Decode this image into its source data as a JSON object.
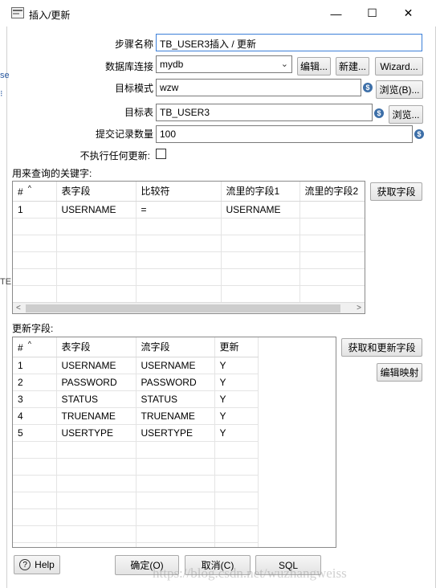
{
  "window": {
    "title": "插入/更新",
    "minimize_glyph": "—",
    "maximize_glyph": "☐",
    "close_glyph": "✕"
  },
  "form": {
    "step_name_label": "步骤名称",
    "step_name_value": "TB_USER3插入 / 更新",
    "db_connection_label": "数据库连接",
    "db_connection_value": "mydb",
    "edit_button": "编辑...",
    "new_button": "新建...",
    "wizard_button": "Wizard...",
    "target_schema_label": "目标模式",
    "target_schema_value": "wzw",
    "browse_b_button": "浏览(B)...",
    "target_table_label": "目标表",
    "target_table_value": "TB_USER3",
    "browse_button": "浏览...",
    "commit_size_label": "提交记录数量",
    "commit_size_value": "100",
    "no_update_label": "不执行任何更新:",
    "no_update_checked": false,
    "variable_icon": "$"
  },
  "key_section": {
    "label": "用来查询的关键字:",
    "get_fields_button": "获取字段",
    "columns": [
      "#",
      "表字段",
      "比较符",
      "流里的字段1",
      "流里的字段2"
    ],
    "rows": [
      [
        "1",
        "USERNAME",
        "=",
        "USERNAME",
        ""
      ]
    ],
    "empty_rows": 6
  },
  "update_section": {
    "label": "更新字段:",
    "get_update_fields_button": "获取和更新字段",
    "edit_mapping_button": "编辑映射",
    "columns": [
      "#",
      "表字段",
      "流字段",
      "更新"
    ],
    "rows": [
      [
        "1",
        "USERNAME",
        "USERNAME",
        "Y"
      ],
      [
        "2",
        "PASSWORD",
        "PASSWORD",
        "Y"
      ],
      [
        "3",
        "STATUS",
        "STATUS",
        "Y"
      ],
      [
        "4",
        "TRUENAME",
        "TRUENAME",
        "Y"
      ],
      [
        "5",
        "USERTYPE",
        "USERTYPE",
        "Y"
      ]
    ],
    "empty_rows": 7
  },
  "footer": {
    "help_button": "Help",
    "ok_button": "确定(O)",
    "cancel_button": "取消(C)",
    "sql_button": "SQL"
  },
  "watermark": "https://blog.csdn.net/wuzhangweiss",
  "colors": {
    "focus_border": "#3c7fd8",
    "variable_icon": "#3d6fa8"
  }
}
